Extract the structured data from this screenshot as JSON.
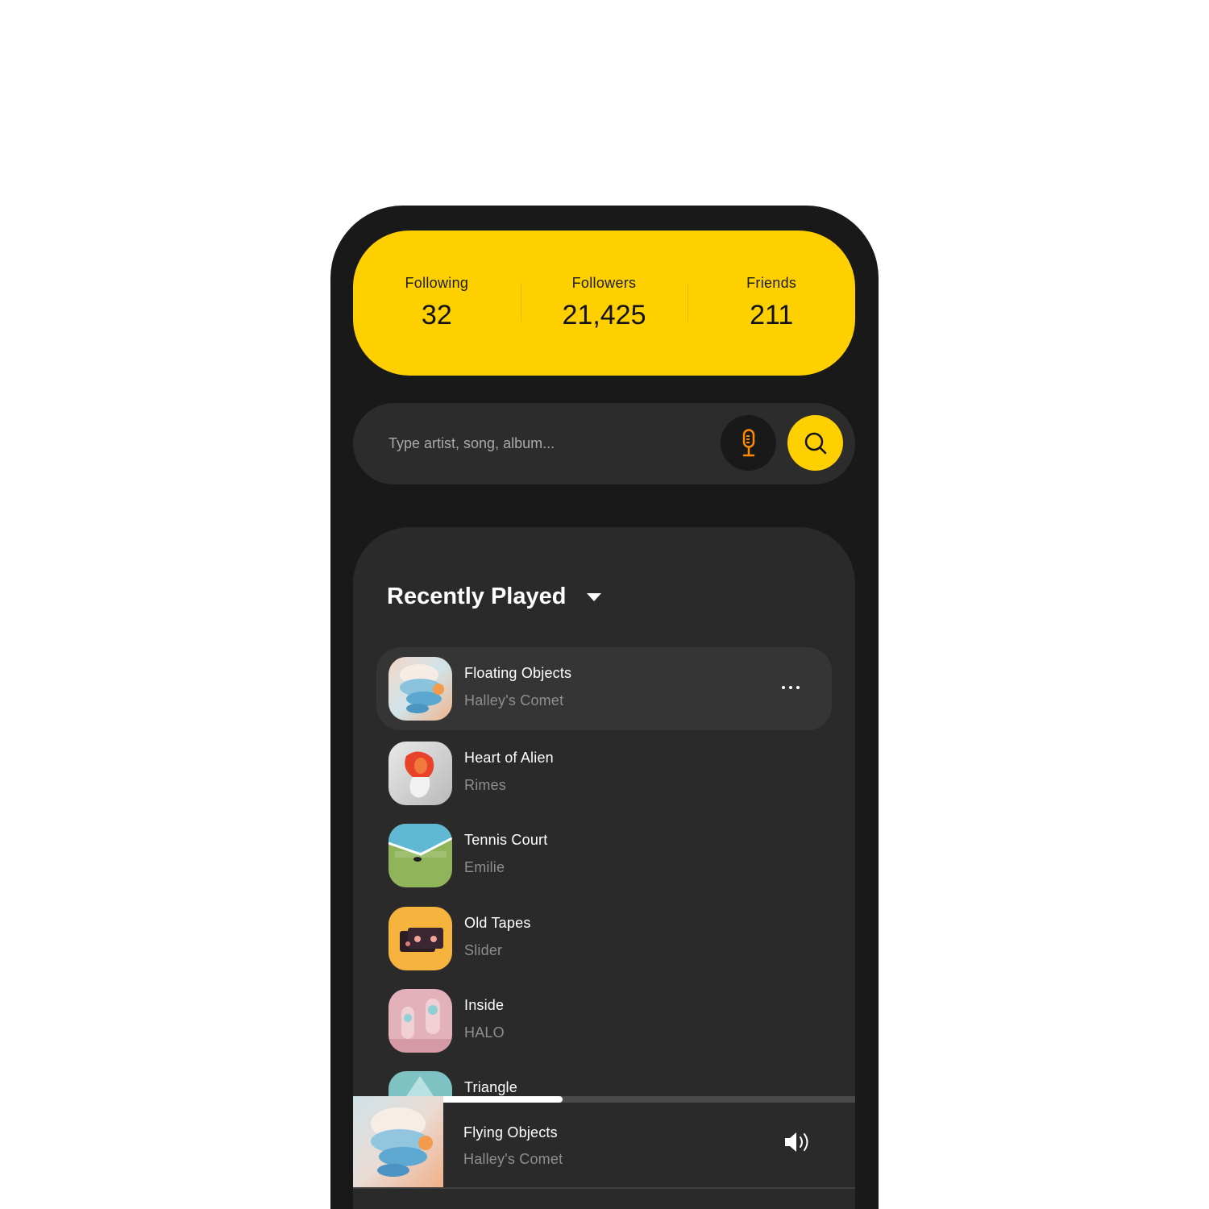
{
  "stats": [
    {
      "label": "Following",
      "value": "32"
    },
    {
      "label": "Followers",
      "value": "21,425"
    },
    {
      "label": "Friends",
      "value": "211"
    }
  ],
  "search": {
    "placeholder": "Type artist, song, album...",
    "mic_icon": "microphone-icon",
    "search_icon": "search-icon"
  },
  "recently_played": {
    "title": "Recently Played",
    "tracks": [
      {
        "title": "Floating Objects",
        "artist": "Halley's Comet",
        "art": "floating-objects-art",
        "active": true
      },
      {
        "title": "Heart of Alien",
        "artist": "Rimes",
        "art": "heart-of-alien-art"
      },
      {
        "title": "Tennis Court",
        "artist": "Emilie",
        "art": "tennis-court-art"
      },
      {
        "title": "Old Tapes",
        "artist": "Slider",
        "art": "old-tapes-art"
      },
      {
        "title": "Inside",
        "artist": "HALO",
        "art": "inside-art"
      },
      {
        "title": "Triangle",
        "artist": "",
        "art": "triangle-art"
      }
    ]
  },
  "now_playing": {
    "title": "Flying Objects",
    "artist": "Halley's Comet",
    "progress": 0.29,
    "volume_icon": "volume-icon"
  },
  "colors": {
    "accent": "#ffd000",
    "background": "#191919",
    "panel": "#2a2a2a",
    "mic_accent": "#ff8a00"
  }
}
